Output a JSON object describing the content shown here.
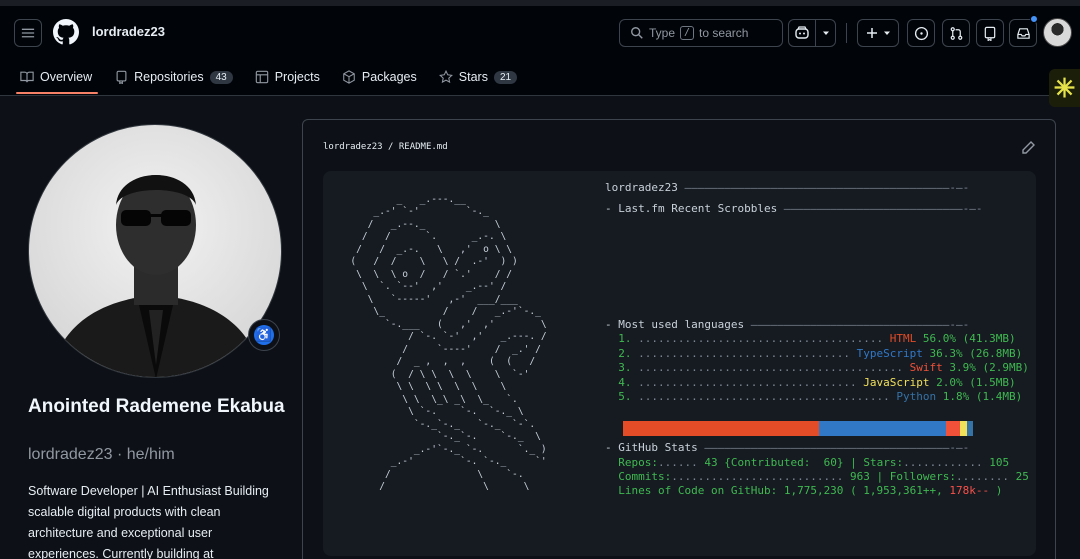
{
  "header": {
    "username": "lordradez23",
    "search_placeholder_prefix": "Type",
    "search_key": "/",
    "search_placeholder_suffix": "to search"
  },
  "tabs": [
    {
      "label": "Overview",
      "icon": "book-icon"
    },
    {
      "label": "Repositories",
      "icon": "repo-icon",
      "count": "43"
    },
    {
      "label": "Projects",
      "icon": "table-icon"
    },
    {
      "label": "Packages",
      "icon": "package-icon"
    },
    {
      "label": "Stars",
      "icon": "star-icon",
      "count": "21"
    }
  ],
  "profile": {
    "fullname": "Anointed Rademene Ekabua",
    "handle": "lordradez23 · he/him",
    "bio": "Software Developer | AI Enthusiast Building scalable digital products with clean architecture and exceptional user experiences. Currently building at"
  },
  "readme": {
    "path": "lordradez23 / README.md",
    "title": "lordradez23",
    "lastfm": "- Last.fm Recent Scrobbles",
    "languages_heading": "- Most used languages",
    "languages": [
      {
        "n": "1.",
        "name": "HTML",
        "pct": "56.0%",
        "size": "(41.3MB)",
        "color": "#e34c26",
        "frac": 0.56
      },
      {
        "n": "2.",
        "name": "TypeScript",
        "pct": "36.3%",
        "size": "(26.8MB)",
        "color": "#3178c6",
        "frac": 0.363
      },
      {
        "n": "3.",
        "name": "Swift",
        "pct": "3.9%",
        "size": "(2.9MB)",
        "color": "#f05138",
        "frac": 0.039
      },
      {
        "n": "4.",
        "name": "JavaScript",
        "pct": "2.0%",
        "size": "(1.5MB)",
        "color": "#f1e05a",
        "frac": 0.02
      },
      {
        "n": "5.",
        "name": "Python",
        "pct": "1.8%",
        "size": "(1.4MB)",
        "color": "#3572a5",
        "frac": 0.018
      }
    ],
    "stats_heading": "- GitHub Stats",
    "repos_label": "Repos:",
    "repos_value": "43",
    "contributed_label": "{Contributed:",
    "contributed_value": "60}",
    "stars_label": "Stars:",
    "stars_value": "105",
    "commits_label": "Commits:",
    "commits_value": "963",
    "followers_label": "Followers:",
    "followers_value": "25",
    "loc_label": "Lines of Code on GitHub:",
    "loc_value": "1,775,230",
    "loc_add": "( 1,953,361++,",
    "loc_del": "178k--",
    "loc_end": ")"
  },
  "colors": {
    "accent": "#f78166",
    "bg": "#0d1117",
    "term_bg": "#161b22",
    "green": "#3fb950"
  }
}
